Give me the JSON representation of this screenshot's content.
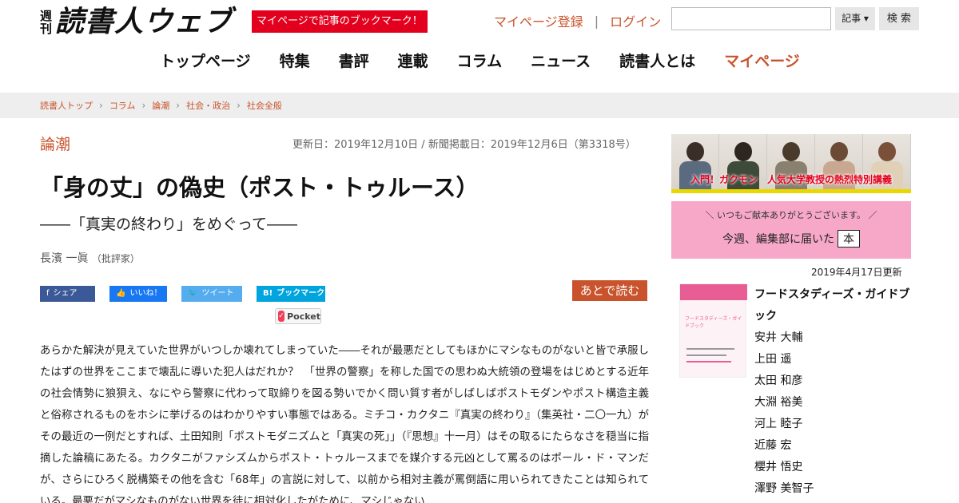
{
  "header": {
    "logo_weekly_top": "週",
    "logo_weekly_bottom": "刊",
    "logo_main": "読書人ウェブ",
    "bookmark_banner": "マイページで記事のブックマーク！",
    "register_link": "マイページ登録",
    "separator": "|",
    "login_link": "ログイン",
    "search_placeholder": "",
    "search_select_value": "記事 ▾",
    "search_button": "検 索"
  },
  "nav": {
    "items": [
      "トップページ",
      "特集",
      "書評",
      "連載",
      "コラム",
      "ニュース",
      "読書人とは",
      "マイページ"
    ],
    "active_color": "#c8532c"
  },
  "breadcrumb": [
    "読書人トップ",
    "コラム",
    "論潮",
    "社会・政治",
    "社会全般"
  ],
  "article": {
    "category": "論潮",
    "dates": "更新日：2019年12月10日 / 新聞掲載日：2019年12月6日（第3318号）",
    "title": "「身の丈」の偽史（ポスト・トゥルース）",
    "subtitle": "――「真実の終わり」をめぐって――",
    "author_name": "長濱 一眞",
    "author_role": "（批評家）",
    "share": {
      "facebook": "シェア",
      "like": "いいね！",
      "twitter": "ツイート",
      "hatena": "ブックマーク",
      "pocket": "Pocket",
      "read_later": "あとで読む"
    },
    "body": "あらかた解決が見えていた世界がいつしか壊れてしまっていた――それが最悪だとしてもほかにマシなものがないと皆で承服したはずの世界をここまで壊乱に導いた犯人はだれか？　「世界の警察」を称した国での思わぬ大統領の登場をはじめとする近年の社会情勢に狼狽え、なにやら警察に代わって取締りを図る勢いでかく問い質す者がしばしばポストモダンやポスト構造主義と俗称されるものをホシに挙げるのはわかりやすい事態ではある。ミチコ・カクタニ『真実の終わり』（集英社・二〇一九）がその最近の一例だとすれば、土田知則「ポストモダニズムと「真実の死」」（『思想』十一月）はその取るにたらなさを穏当に指摘した論稿にあたる。カクタニがファシズムからポスト・トゥルースまでを媒介する元凶として罵るのはポール・ド・マンだが、さらにひろく脱構築その他を含む「68年」の言説に対して、以前から相対主義が罵倒語に用いられてきたことは知られている。最悪だがマシなものがない世界を徒に相対化したがために、マシじゃない"
  },
  "sidebar": {
    "banner1_caption": "入門！ガクモン　人気大学教授の熱烈特別講義",
    "banner2_top": "＼ いつもご献本ありがとうございます。 ／",
    "banner2_main": "今週、編集部に届いた",
    "banner2_box": "本",
    "updated": "2019年4月17日更新",
    "book_title": "フードスタディーズ・ガイドブック",
    "authors": [
      "安井 大輔",
      "上田 遥",
      "太田 和彦",
      "大淵 裕美",
      "河上 睦子",
      "近藤 宏",
      "櫻井 悟史",
      "澤野 美智子"
    ]
  }
}
